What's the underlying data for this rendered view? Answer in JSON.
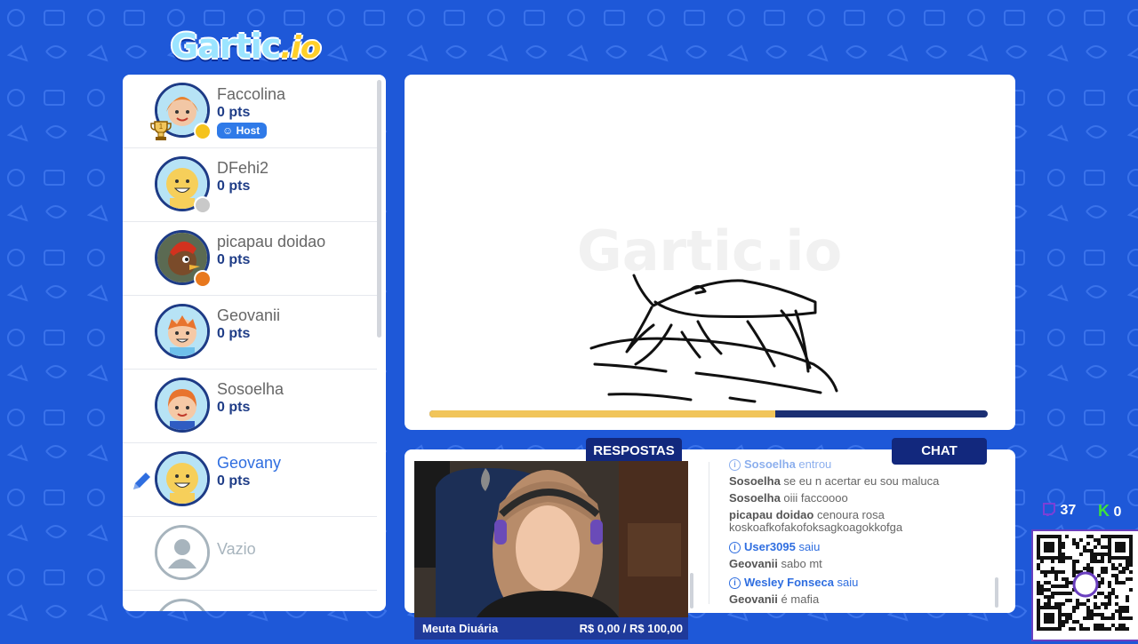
{
  "logo": {
    "text": "Gartic",
    "suffix": ".io"
  },
  "players": [
    {
      "name": "Faccolina",
      "points": "0 pts",
      "host_label": "Host",
      "dot_color": "#f5c31d",
      "skin": "#f2c7a5",
      "hair": "#e8822e",
      "rank": "1"
    },
    {
      "name": "DFehi2",
      "points": "0 pts",
      "dot_color": "#c9c9c9",
      "skin": "#f6cf5a",
      "hair": "#f6cf5a"
    },
    {
      "name": "picapau doidao",
      "points": "0 pts",
      "dot_color": "#e8781d",
      "skin": "#7a4b2a",
      "hair": "#d2321e"
    },
    {
      "name": "Geovanii",
      "points": "0 pts",
      "dot_color": null,
      "skin": "#f5c9a6",
      "hair": "#e8742e"
    },
    {
      "name": "Sosoelha",
      "points": "0 pts",
      "dot_color": null,
      "skin": "#f5c9a6",
      "hair": "#e8742e"
    },
    {
      "name": "Geovany",
      "points": "0 pts",
      "dot_color": null,
      "skin": "#f6cf5a",
      "hair": "#f6cf5a"
    },
    {
      "name": "Vazio",
      "points": "",
      "dot_color": null
    }
  ],
  "timer": {
    "progress": 0.62
  },
  "tabs": {
    "answers": "RESPOSTAS",
    "chat": "CHAT"
  },
  "stream": {
    "goal_label": "Meuta Diuária",
    "goal_value": "R$ 0,00 / R$ 100,00"
  },
  "chat": [
    {
      "type": "sys",
      "user": "Sosoelha",
      "text": "entrou"
    },
    {
      "type": "msg",
      "user": "Sosoelha",
      "text": "se eu n acertar eu sou maluca"
    },
    {
      "type": "msg",
      "user": "Sosoelha",
      "text": "oiii faccoooo"
    },
    {
      "type": "msg",
      "user": "picapau doidao",
      "text": "cenoura rosa koskoafkofakofoksagkoagokkofga"
    },
    {
      "type": "sys",
      "user": "User3095",
      "text": "saiu"
    },
    {
      "type": "msg",
      "user": "Geovanii",
      "text": "sabo mt"
    },
    {
      "type": "sys",
      "user": "Wesley Fonseca",
      "text": "saiu"
    },
    {
      "type": "msg",
      "user": "Geovanii",
      "text": "é mafia"
    }
  ],
  "counters": {
    "viewers": "37",
    "kick": "0"
  },
  "colors": {
    "background": "#1e58d8",
    "navy": "#12287d",
    "accent_blue": "#2f6ee0",
    "timer": "#f1c55a"
  }
}
